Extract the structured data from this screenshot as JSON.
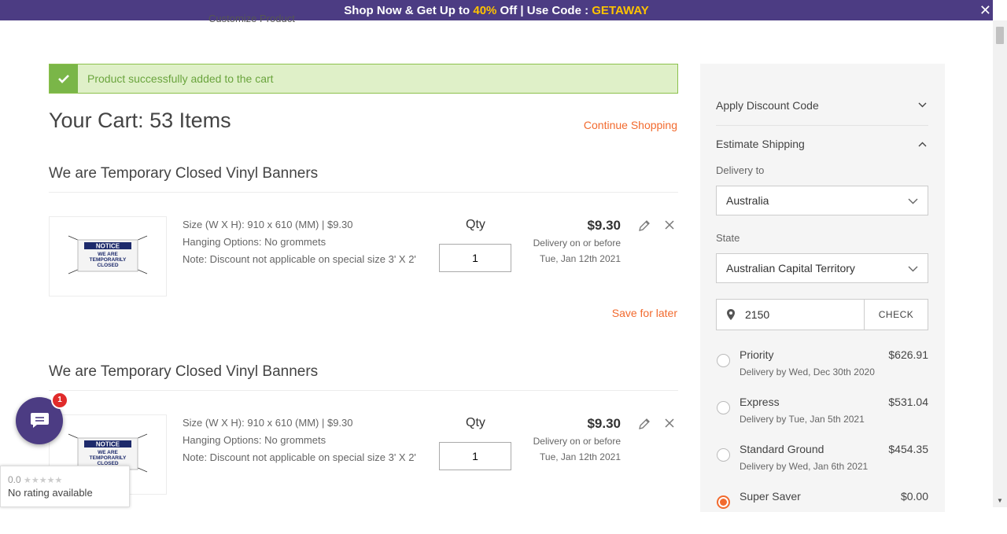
{
  "promo": {
    "text_before": "Shop Now & Get Up to ",
    "discount": "40%",
    "text_after": " Off | Use Code : ",
    "code": "GETAWAY",
    "close_label": "✕"
  },
  "cut_off_text": "Customize Product",
  "alert": {
    "message": "Product successfully added to the cart"
  },
  "cart": {
    "title": "Your Cart: 53 Items",
    "continue_label": "Continue Shopping",
    "items": [
      {
        "title": "We are Temporary Closed Vinyl Banners",
        "banner_notice": "NOTICE",
        "banner_line1": "WE ARE",
        "banner_line2": "TEMPORARILY",
        "banner_line3": "CLOSED",
        "size": "Size (W X H): 910 x 610 (MM) | $9.30",
        "hanging": "Hanging Options: No grommets",
        "note": "Note: Discount not applicable on special size 3' X 2'",
        "qty_label": "Qty",
        "qty": "1",
        "price": "$9.30",
        "delivery_line1": "Delivery on or before",
        "delivery_line2": "Tue, Jan 12th 2021",
        "save_label": "Save for later"
      },
      {
        "title": "We are Temporary Closed Vinyl Banners",
        "banner_notice": "NOTICE",
        "banner_line1": "WE ARE",
        "banner_line2": "TEMPORARILY",
        "banner_line3": "CLOSED",
        "size": "Size (W X H): 910 x 610 (MM) | $9.30",
        "hanging": "Hanging Options: No grommets",
        "note": "Note: Discount not applicable on special size 3' X 2'",
        "qty_label": "Qty",
        "qty": "1",
        "price": "$9.30",
        "delivery_line1": "Delivery on or before",
        "delivery_line2": "Tue, Jan 12th 2021"
      }
    ]
  },
  "sidebar": {
    "discount_label": "Apply Discount Code",
    "shipping_label": "Estimate Shipping",
    "delivery_to_label": "Delivery to",
    "country": "Australia",
    "state_label": "State",
    "state": "Australian Capital Territory",
    "zip": "2150",
    "check_label": "CHECK",
    "options": [
      {
        "name": "Priority",
        "price": "$626.91",
        "date": "Delivery by Wed, Dec 30th 2020",
        "selected": false
      },
      {
        "name": "Express",
        "price": "$531.04",
        "date": "Delivery by Tue, Jan 5th 2021",
        "selected": false
      },
      {
        "name": "Standard Ground",
        "price": "$454.35",
        "date": "Delivery by Wed, Jan 6th 2021",
        "selected": false
      },
      {
        "name": "Super Saver",
        "price": "$0.00",
        "date": "",
        "selected": true
      }
    ]
  },
  "chat": {
    "badge": "1"
  },
  "rating": {
    "score": "0.0",
    "stars": "★★★★★",
    "text": "No rating available"
  },
  "colors": {
    "brand": "#4c3c83",
    "accent": "#f26a2e",
    "promo_highlight": "#ffc300",
    "success": "#7ab648"
  }
}
